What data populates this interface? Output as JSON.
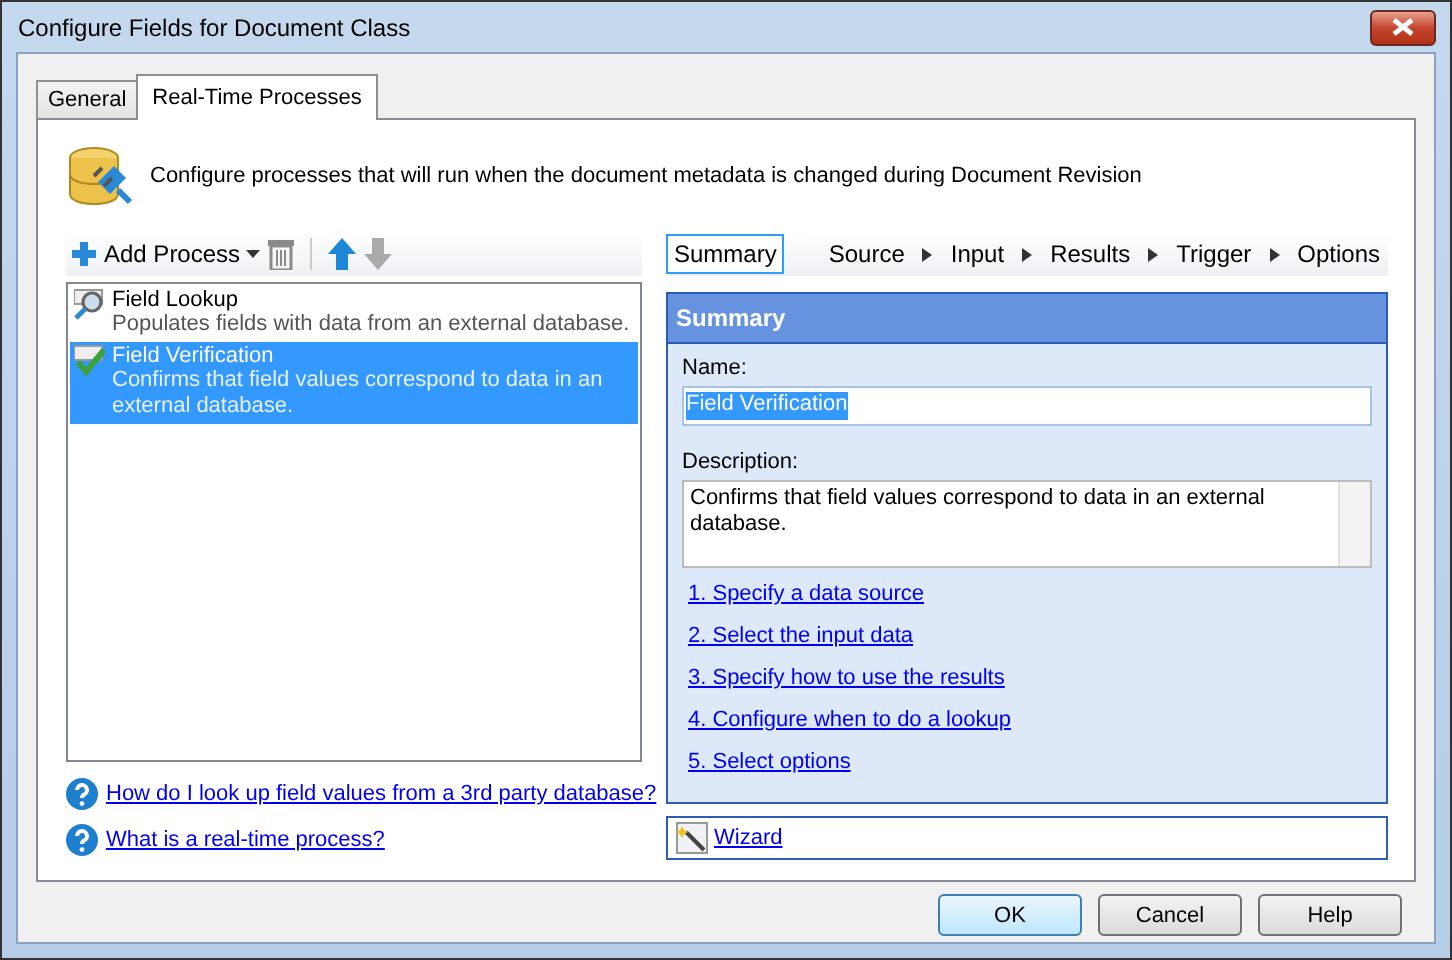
{
  "window": {
    "title": "Configure Fields for Document Class"
  },
  "tabs": [
    {
      "label": "General",
      "selected": false
    },
    {
      "label": "Real-Time Processes",
      "selected": true
    }
  ],
  "header": {
    "text": "Configure processes that will run when the document metadata is changed during Document Revision"
  },
  "toolbar": {
    "add_label": "Add Process",
    "delete_disabled": false,
    "up_disabled": false,
    "down_disabled": true
  },
  "processes": [
    {
      "kind": "lookup",
      "title": "Field Lookup",
      "description": "Populates fields with data from an external database.",
      "selected": false
    },
    {
      "kind": "verify",
      "title": "Field Verification",
      "description": "Confirms that field values correspond to data in an external database.",
      "selected": true
    }
  ],
  "help_links": [
    "How do I look up field values from a 3rd party database?",
    "What is a real-time process?"
  ],
  "steps": [
    {
      "label": "Summary",
      "selected": true
    },
    {
      "label": "Source",
      "selected": false
    },
    {
      "label": "Input",
      "selected": false
    },
    {
      "label": "Results",
      "selected": false
    },
    {
      "label": "Trigger",
      "selected": false
    },
    {
      "label": "Options",
      "selected": false
    }
  ],
  "summary": {
    "title": "Summary",
    "name_label": "Name:",
    "name_value": "Field Verification",
    "description_label": "Description:",
    "description_value": "Confirms that field values correspond to data in an external database.",
    "links": [
      "1. Specify a data source",
      "2. Select the input data",
      "3. Specify how to use the results",
      "4. Configure when to do a lookup",
      "5. Select options"
    ]
  },
  "wizard": {
    "label": "Wizard"
  },
  "buttons": [
    {
      "label": "OK",
      "default": true
    },
    {
      "label": "Cancel",
      "default": false
    },
    {
      "label": "Help",
      "default": false
    }
  ]
}
